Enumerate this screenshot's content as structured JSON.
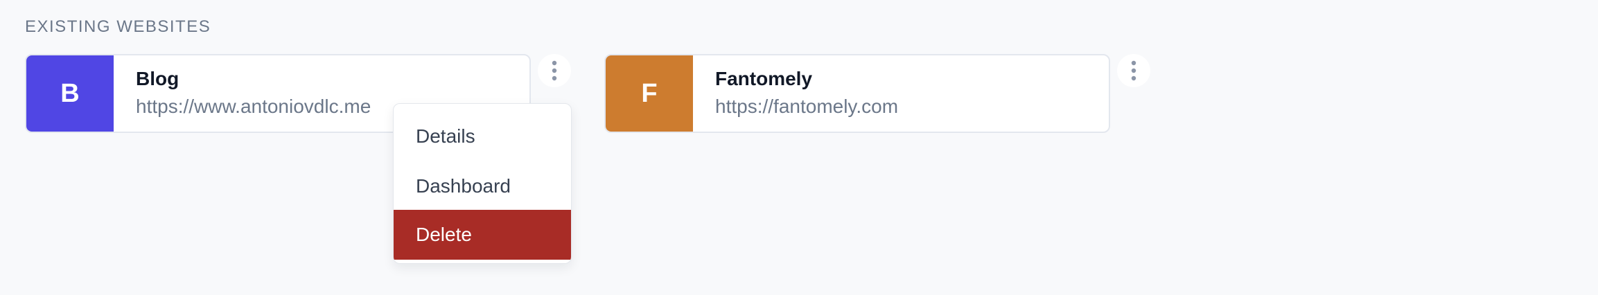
{
  "section": {
    "heading": "EXISTING WEBSITES"
  },
  "websites": [
    {
      "initial": "B",
      "name": "Blog",
      "url": "https://www.antoniovdlc.me",
      "color": "#5046e4"
    },
    {
      "initial": "F",
      "name": "Fantomely",
      "url": "https://fantomely.com",
      "color": "#cd7c2f"
    }
  ],
  "menu": {
    "items": [
      {
        "label": "Details"
      },
      {
        "label": "Dashboard"
      },
      {
        "label": "Delete",
        "highlight_color": "#a82c26"
      }
    ]
  },
  "icons": {
    "more": "more-vertical-icon"
  }
}
